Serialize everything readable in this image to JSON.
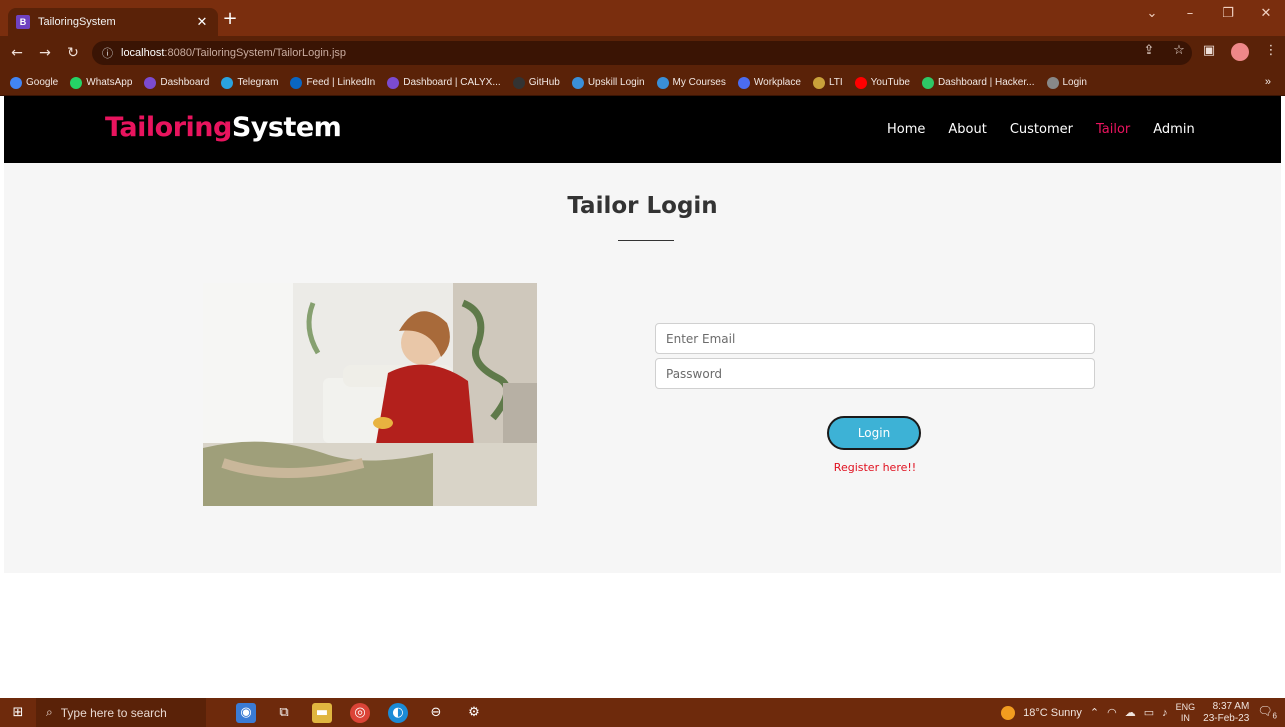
{
  "browser": {
    "tab_title": "TailoringSystem",
    "tab_favicon": "B",
    "url_host": "localhost",
    "url_path": ":8080/TailoringSystem/TailorLogin.jsp",
    "bookmarks": [
      {
        "label": "Google",
        "icon": "google-icon",
        "color": "#4285f4"
      },
      {
        "label": "WhatsApp",
        "icon": "whatsapp-icon",
        "color": "#25d366"
      },
      {
        "label": "Dashboard",
        "icon": "dashboard-icon",
        "color": "#7b4bd0"
      },
      {
        "label": "Telegram",
        "icon": "telegram-icon",
        "color": "#2aa3df"
      },
      {
        "label": "Feed | LinkedIn",
        "icon": "linkedin-icon",
        "color": "#0a66c2"
      },
      {
        "label": "Dashboard | CALYX...",
        "icon": "calyx-icon",
        "color": "#7b4bd0"
      },
      {
        "label": "GitHub",
        "icon": "github-icon",
        "color": "#333333"
      },
      {
        "label": "Upskill Login",
        "icon": "upskill-icon",
        "color": "#3a8fd8"
      },
      {
        "label": "My Courses",
        "icon": "courses-icon",
        "color": "#3a8fd8"
      },
      {
        "label": "Workplace",
        "icon": "workplace-icon",
        "color": "#4b6cf0"
      },
      {
        "label": "LTI",
        "icon": "lti-icon",
        "color": "#c9a13a"
      },
      {
        "label": "YouTube",
        "icon": "youtube-icon",
        "color": "#ff0000"
      },
      {
        "label": "Dashboard | Hacker...",
        "icon": "hackerrank-icon",
        "color": "#2ec866"
      },
      {
        "label": "Login",
        "icon": "login-icon",
        "color": "#888888"
      }
    ],
    "bookmarks_more": "»"
  },
  "site": {
    "logo_part1": "Tailoring",
    "logo_part2": "System",
    "nav": [
      {
        "label": "Home",
        "active": false
      },
      {
        "label": "About",
        "active": false
      },
      {
        "label": "Customer",
        "active": false
      },
      {
        "label": "Tailor",
        "active": true
      },
      {
        "label": "Admin",
        "active": false
      }
    ],
    "accent_color": "#e8145e"
  },
  "login": {
    "title": "Tailor Login",
    "email_placeholder": "Enter Email",
    "password_placeholder": "Password",
    "button_label": "Login",
    "register_label": "Register here!!",
    "button_color": "#3db2d6"
  },
  "taskbar": {
    "search_placeholder": "Type here to search",
    "weather": "18°C  Sunny",
    "lang_top": "ENG",
    "lang_bottom": "IN",
    "time": "8:37 AM",
    "date": "23-Feb-23",
    "notifications": "6"
  }
}
